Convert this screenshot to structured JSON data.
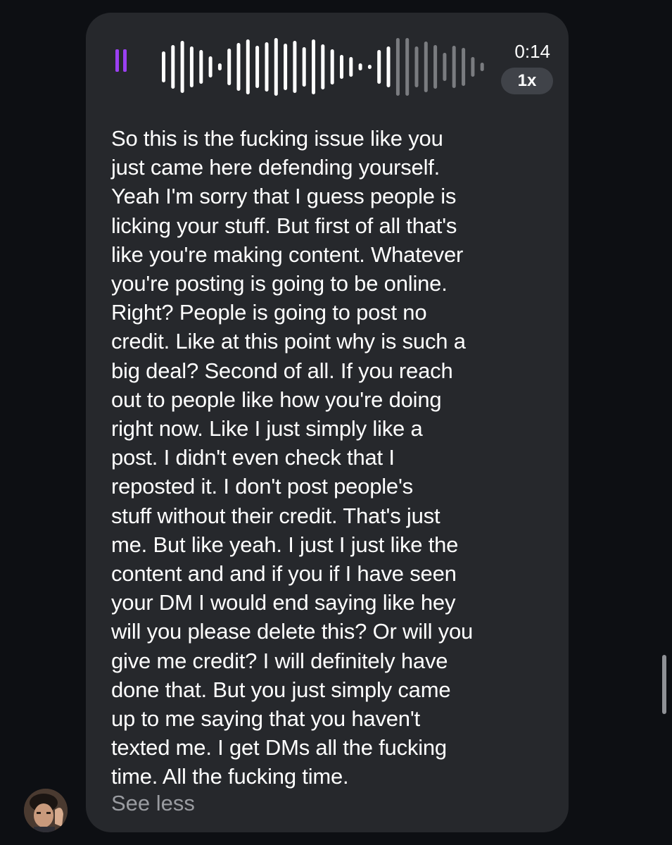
{
  "voice_message": {
    "state_icon": "pause-icon",
    "duration": "0:14",
    "speed": "1x",
    "waveform_icon": "waveform-icon",
    "playback_progress": 0.7,
    "accent_color": "#9b40f2"
  },
  "transcript": {
    "lines": [
      "So this is the fucking issue like you",
      "just came here defending yourself.",
      "Yeah I'm sorry that I guess people is",
      "licking your stuff. But first of all that's",
      "like you're making content. Whatever",
      "you're posting is going to be online.",
      "Right? People is going to post no",
      "credit. Like at this point why is such a",
      "big deal? Second of all. If you reach",
      "out to people like how you're doing",
      "right now. Like I just simply like a",
      "post. I didn't even check that I",
      "reposted it. I don't post people's",
      "stuff without their credit. That's just",
      "me. But like yeah. I just I just like the",
      "content and and if you if I have seen",
      "your DM I would end saying like hey",
      "will you please delete this? Or will you",
      "give me credit? I will definitely have",
      "done that. But you just simply came",
      "up to me saying that you haven't",
      "texted me. I get DMs all the fucking",
      "time. All the fucking time."
    ],
    "toggle_label": "See less"
  },
  "sender": {
    "avatar_icon": "avatar-icon"
  }
}
